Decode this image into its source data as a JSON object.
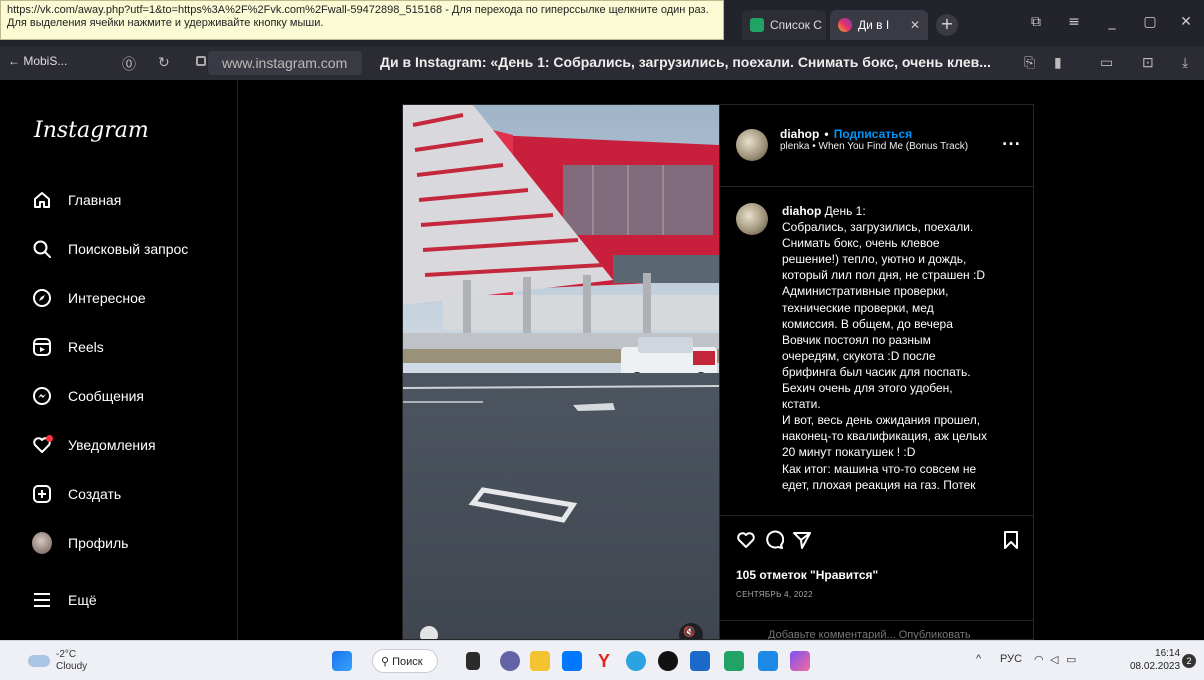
{
  "tooltip": {
    "line1": "https://vk.com/away.php?utf=1&to=https%3A%2F%2Fvk.com%2Fwall-59472898_515168 - Для перехода по гиперссылке щелкните один раз.",
    "line2": "Для выделения ячейки нажмите и удерживайте кнопку мыши."
  },
  "tabs": [
    {
      "label": "Список С",
      "icon": "sheets-icon",
      "color": "#21a366"
    },
    {
      "label": "Ди в I",
      "icon": "instagram-icon",
      "color": "#e1306c"
    }
  ],
  "address_bar": {
    "back_label": "← MobiS...",
    "url": "www.instagram.com",
    "page_title": "Ди в Instagram: «День 1: Собрались, загрузились, поехали. Снимать бокс, очень клев..."
  },
  "sidebar": {
    "logo": "Instagram",
    "items": [
      {
        "label": "Главная",
        "icon": "home-icon"
      },
      {
        "label": "Поисковый запрос",
        "icon": "search-icon"
      },
      {
        "label": "Интересное",
        "icon": "explore-icon"
      },
      {
        "label": "Reels",
        "icon": "reels-icon"
      },
      {
        "label": "Сообщения",
        "icon": "messenger-icon"
      },
      {
        "label": "Уведомления",
        "icon": "heart-icon"
      },
      {
        "label": "Создать",
        "icon": "create-icon"
      },
      {
        "label": "Профиль",
        "icon": "avatar"
      },
      {
        "label": "Ещё",
        "icon": "menu-icon"
      }
    ]
  },
  "post": {
    "header": {
      "username": "diahop",
      "separator": "•",
      "follow": "Подписаться",
      "music": "plenka • When You Find Me (Bonus Track)",
      "more": "..."
    },
    "caption": {
      "username": "diahop",
      "text_lines": [
        "День 1:",
        "Собрались, загрузились, поехали.",
        "Снимать бокс, очень клевое",
        "решение!) тепло, уютно и дождь,",
        "который лил пол дня, не страшен :D",
        "Административные проверки,",
        "технические проверки, мед",
        "комиссия. В общем, до вечера",
        "Вовчик постоял по разным",
        "очередям, скукота :D после",
        "брифинга был часик для поспать.",
        "Бехич очень для этого удобен,",
        "кстати.",
        "И вот, весь день ожидания прошел,",
        "наконец-то квалификация, аж целых",
        "20 минут покатушек ! :D",
        "Как итог: машина что-то совсем не",
        "едет, плохая реакция на газ. Потек"
      ]
    },
    "likes": "105 отметок \"Нравится\"",
    "date": "СЕНТЯБРЬ 4, 2022",
    "comment_placeholder": "Добавьте комментарий...   Опубликовать"
  },
  "taskbar": {
    "weather_temp": "-2°C",
    "weather_desc": "Cloudy",
    "search_label": "Поиск",
    "lang": "РУС",
    "time": "16:14",
    "date": "08.02.2023"
  }
}
